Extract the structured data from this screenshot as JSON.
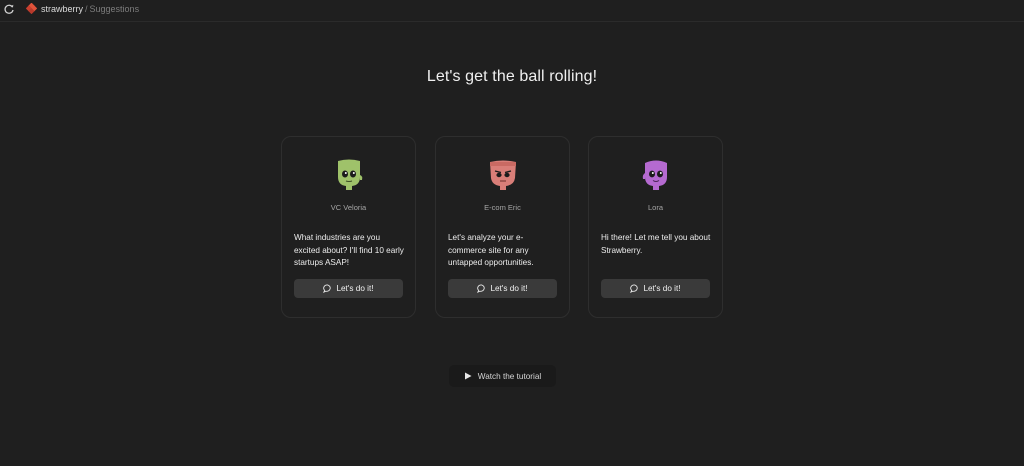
{
  "breadcrumb": {
    "app": "strawberry",
    "separator": "/",
    "page": "Suggestions"
  },
  "main": {
    "title": "Let's get the ball rolling!",
    "cards": [
      {
        "persona": "VC Veloria",
        "prompt": "What industries are you excited about? I'll find 10 early startups ASAP!",
        "button": "Let's do it!",
        "avatar_color": "#9fc26a"
      },
      {
        "persona": "E-com Eric",
        "prompt": "Let's analyze your e-commerce site for any untapped opportunities.",
        "button": "Let's do it!",
        "avatar_color": "#d97e78"
      },
      {
        "persona": "Lora",
        "prompt": "Hi there! Let me tell you about Strawberry.",
        "button": "Let's do it!",
        "avatar_color": "#b56ad0"
      }
    ],
    "tutorial_label": "Watch the tutorial"
  },
  "icons": {
    "reload": "reload-icon",
    "logo": "strawberry-logo",
    "chat": "chat-bubble-icon",
    "play": "play-icon"
  },
  "colors": {
    "background": "#1f1f1f",
    "button": "#3a3a3a",
    "accent": "#e0533a"
  }
}
